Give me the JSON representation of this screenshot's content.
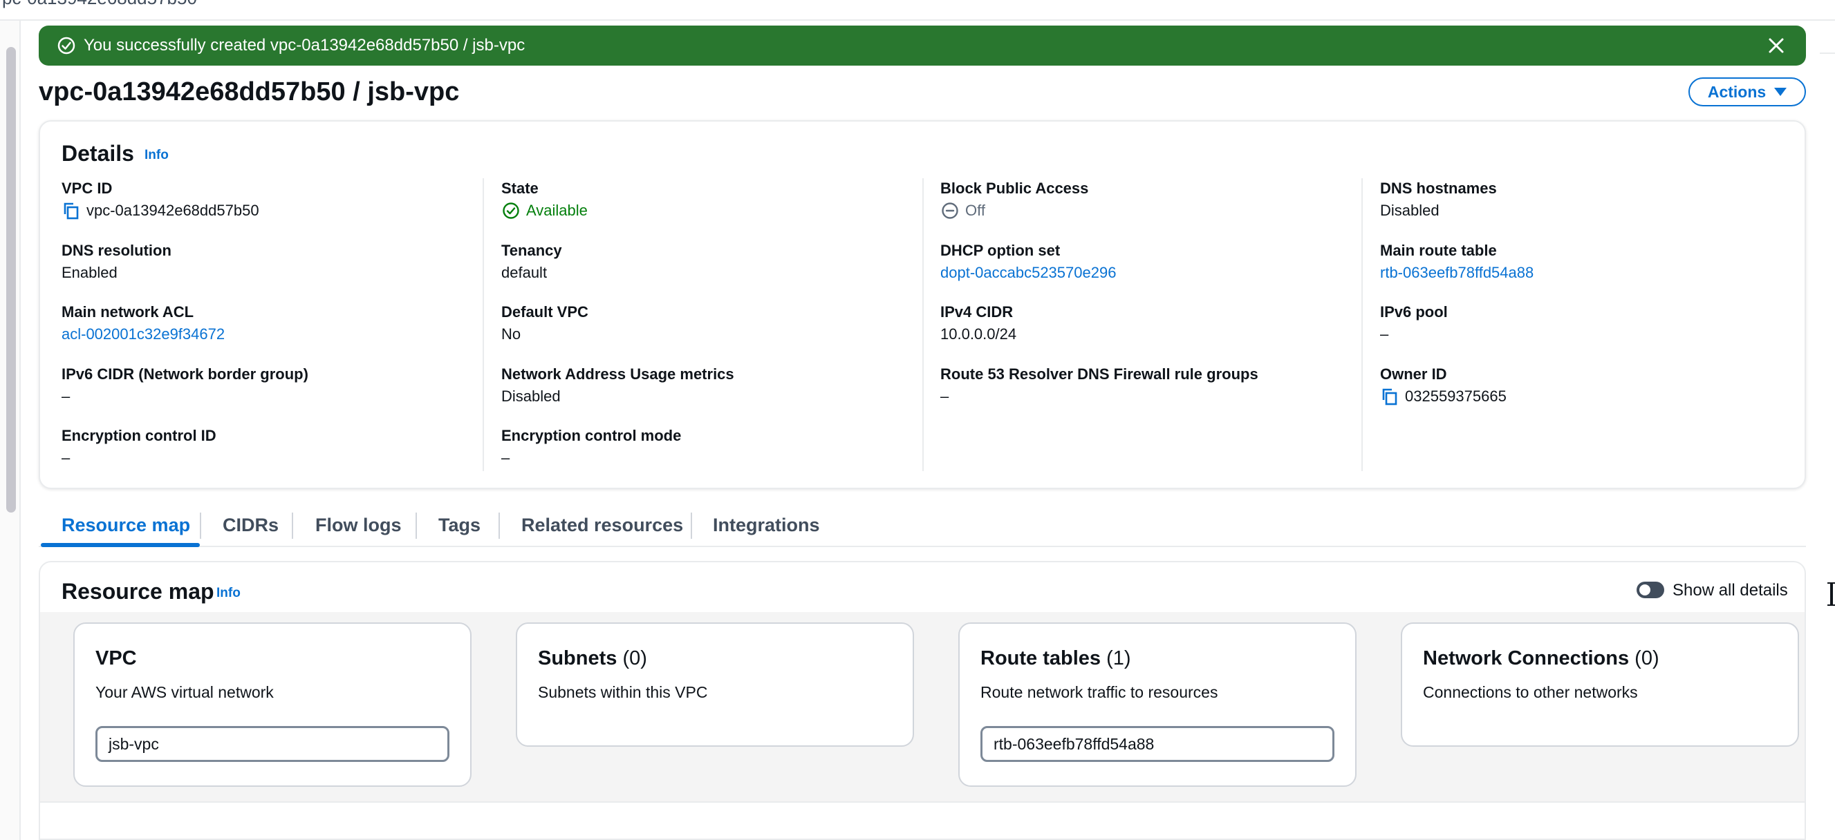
{
  "top_breadcrumb": "vpc-0a13942e68dd57b50",
  "flash": {
    "message": "You successfully created vpc-0a13942e68dd57b50 / jsb-vpc",
    "color": "#29772f"
  },
  "page": {
    "title": "vpc-0a13942e68dd57b50 / jsb-vpc",
    "actions_label": "Actions"
  },
  "details": {
    "title": "Details",
    "info": "Info",
    "columns": [
      [
        {
          "key": "VPC ID",
          "value": "vpc-0a13942e68dd57b50"
        },
        {
          "key": "DNS resolution",
          "value": "Enabled"
        },
        {
          "key": "Main network ACL",
          "value": "acl-002001c32e9f34672"
        },
        {
          "key": "IPv6 CIDR (Network border group)",
          "value": "–"
        },
        {
          "key": "Encryption control ID",
          "value": "–"
        }
      ],
      [
        {
          "key": "State",
          "value": "Available"
        },
        {
          "key": "Tenancy",
          "value": "default"
        },
        {
          "key": "Default VPC",
          "value": "No"
        },
        {
          "key": "Network Address Usage metrics",
          "value": "Disabled"
        },
        {
          "key": "Encryption control mode",
          "value": "–"
        }
      ],
      [
        {
          "key": "Block Public Access",
          "value": "Off"
        },
        {
          "key": "DHCP option set",
          "value": "dopt-0accabc523570e296"
        },
        {
          "key": "IPv4 CIDR",
          "value": "10.0.0.0/24"
        },
        {
          "key": "Route 53 Resolver DNS Firewall rule groups",
          "value": "–"
        }
      ],
      [
        {
          "key": "DNS hostnames",
          "value": "Disabled"
        },
        {
          "key": "Main route table",
          "value": "rtb-063eefb78ffd54a88"
        },
        {
          "key": "IPv6 pool",
          "value": "–"
        },
        {
          "key": "Owner ID",
          "value": "032559375665"
        }
      ]
    ]
  },
  "tabs": [
    "Resource map",
    "CIDRs",
    "Flow logs",
    "Tags",
    "Related resources",
    "Integrations"
  ],
  "resource_map": {
    "title": "Resource map",
    "info": "Info",
    "show_all_details": "Show all details",
    "cards": [
      {
        "title": "VPC",
        "count": "",
        "subtitle": "Your AWS virtual network",
        "item": "jsb-vpc"
      },
      {
        "title": "Subnets",
        "count": "(0)",
        "subtitle": "Subnets within this VPC",
        "item": ""
      },
      {
        "title": "Route tables",
        "count": "(1)",
        "subtitle": "Route network traffic to resources",
        "item": "rtb-063eefb78ffd54a88"
      },
      {
        "title": "Network Connections",
        "count": "(0)",
        "subtitle": "Connections to other networks",
        "item": ""
      }
    ]
  },
  "colors": {
    "link": "#0972d3",
    "success_text": "#037f0c",
    "flash_bg": "#29772f"
  }
}
